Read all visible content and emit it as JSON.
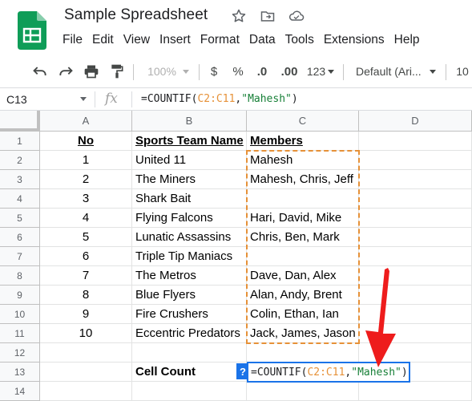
{
  "app": {
    "doc_title": "Sample Spreadsheet",
    "menus": [
      "File",
      "Edit",
      "View",
      "Insert",
      "Format",
      "Data",
      "Tools",
      "Extensions",
      "Help"
    ]
  },
  "toolbar": {
    "zoom": "100%",
    "currency": "$",
    "percent": "%",
    "decrease_decimal": ".0",
    "increase_decimal": ".00",
    "more_formats": "123",
    "font": "Default (Ari...",
    "font_size": "10"
  },
  "formula_bar": {
    "name_box": "C13",
    "fx": "fx",
    "formula_prefix": "=COUNTIF(",
    "formula_range": "C2:C11",
    "formula_comma": ",",
    "formula_criteria": "\"Mahesh\"",
    "formula_suffix": ")"
  },
  "grid": {
    "columns": [
      "A",
      "B",
      "C",
      "D"
    ],
    "rows": [
      "1",
      "2",
      "3",
      "4",
      "5",
      "6",
      "7",
      "8",
      "9",
      "10",
      "11",
      "12",
      "13",
      "14"
    ],
    "headers": {
      "no": "No",
      "team": "Sports Team Name",
      "members": "Members"
    },
    "data": [
      {
        "no": "1",
        "team": "United 11",
        "members": "Mahesh"
      },
      {
        "no": "2",
        "team": "The Miners",
        "members": "Mahesh, Chris, Jeff"
      },
      {
        "no": "3",
        "team": "Shark Bait",
        "members": ""
      },
      {
        "no": "4",
        "team": "Flying Falcons",
        "members": "Hari, David, Mike"
      },
      {
        "no": "5",
        "team": "Lunatic Assassins",
        "members": "Chris, Ben, Mark"
      },
      {
        "no": "6",
        "team": "Triple Tip Maniacs",
        "members": ""
      },
      {
        "no": "7",
        "team": "The Metros",
        "members": "Dave, Dan, Alex"
      },
      {
        "no": "8",
        "team": "Blue Flyers",
        "members": "Alan, Andy, Brent"
      },
      {
        "no": "9",
        "team": "Fire Crushers",
        "members": "Colin, Ethan, Ian"
      },
      {
        "no": "10",
        "team": "Eccentric Predators",
        "members": "Jack, James, Jason"
      }
    ],
    "cell_count_label": "Cell Count",
    "help_badge": "?"
  },
  "colors": {
    "accent": "#1a73e8",
    "range_highlight": "#e69138",
    "string_highlight": "#188038",
    "arrow": "#ee1c1c"
  }
}
